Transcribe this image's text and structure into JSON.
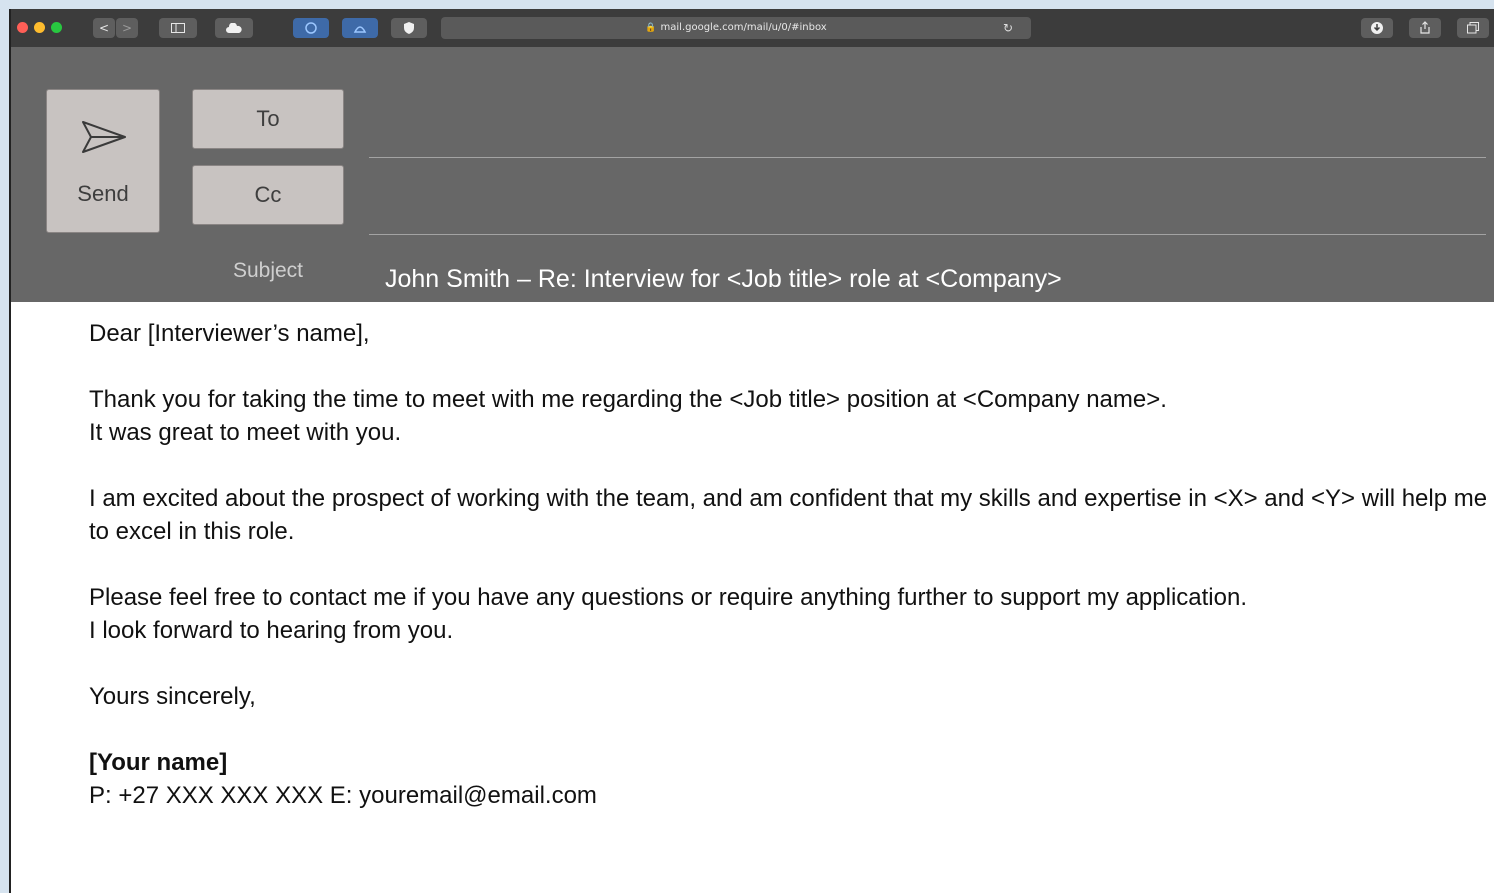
{
  "browser": {
    "url": "mail.google.com/mail/u/0/#inbox",
    "buttons": {
      "back": "<",
      "forward": ">"
    }
  },
  "compose": {
    "send_label": "Send",
    "to_label": "To",
    "cc_label": "Cc",
    "subject_label": "Subject",
    "subject_value": "John Smith – Re: Interview for <Job title> role at <Company>"
  },
  "body": {
    "greeting": "Dear [Interviewer’s name],",
    "para1_line1": "Thank you for taking the time to meet with me regarding the <Job title> position at <Company name>.",
    "para1_line2": "It was great to meet with you.",
    "para2": "I am excited about the prospect of working with the team, and am confident that my skills and expertise in <X> and <Y> will help me to excel in this role.",
    "para3_line1": "Please feel free to contact me if you have any questions or require anything further to support my application.",
    "para3_line2": "I look forward to hearing from you.",
    "closing": "Yours sincerely,",
    "name": "[Your name]",
    "contact": "P: +27 XXX XXX XXX E: youremail@email.com"
  }
}
